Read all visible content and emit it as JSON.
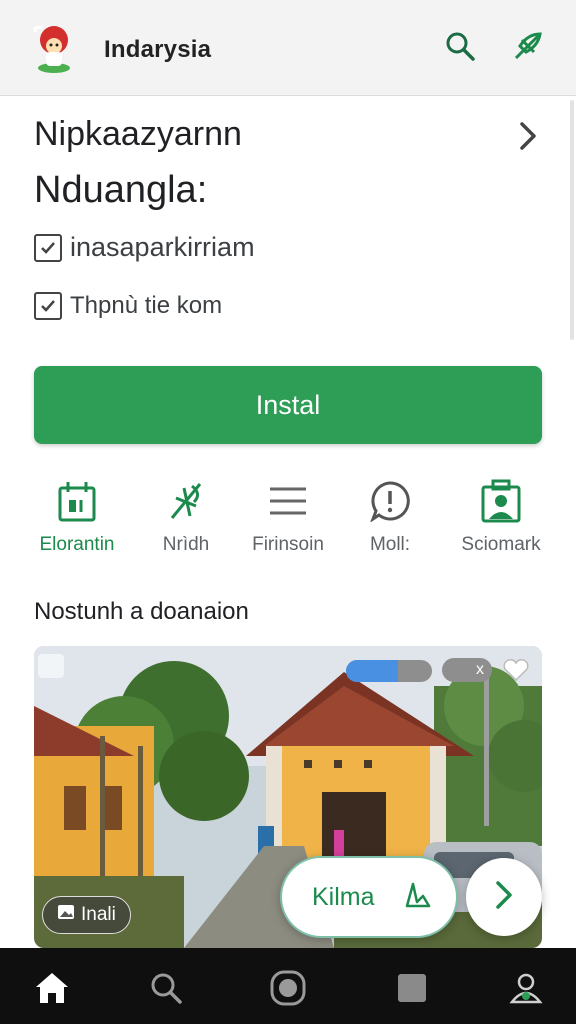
{
  "appbar": {
    "title": "Indarysia",
    "icons": [
      "mascot-logo",
      "search-icon",
      "leaf-action-icon"
    ]
  },
  "header": {
    "line1": "Nipkaazyarnn",
    "line2": "Nduangla:"
  },
  "checks": [
    {
      "label": "inasaparkirriam",
      "checked": true
    },
    {
      "label": "Thpnù tie kom",
      "checked": true
    }
  ],
  "install_label": "Instal",
  "quick_actions": [
    {
      "label": "Elorantin",
      "icon": "calendar-icon",
      "active": true
    },
    {
      "label": "Nrìdh",
      "icon": "leaf-icon",
      "active": false
    },
    {
      "label": "Firinsoin",
      "icon": "menu-icon",
      "active": false
    },
    {
      "label": "Moll:",
      "icon": "alert-icon",
      "active": false
    },
    {
      "label": "Sciomark",
      "icon": "photo-icon",
      "active": false
    }
  ],
  "section_title": "Nostunh a doanaion",
  "card": {
    "chip_label": "Inali",
    "pill_close": "x",
    "progress": 0.6
  },
  "float_pill_label": "Kilma",
  "nav": [
    "home-icon",
    "search-icon",
    "circle-icon",
    "square-icon",
    "profile-icon"
  ],
  "colors": {
    "accent": "#2e9e57",
    "accent_text": "#1b8a4c",
    "bar_bg": "#f3f3f3",
    "nav_bg": "#0f0f0f"
  }
}
